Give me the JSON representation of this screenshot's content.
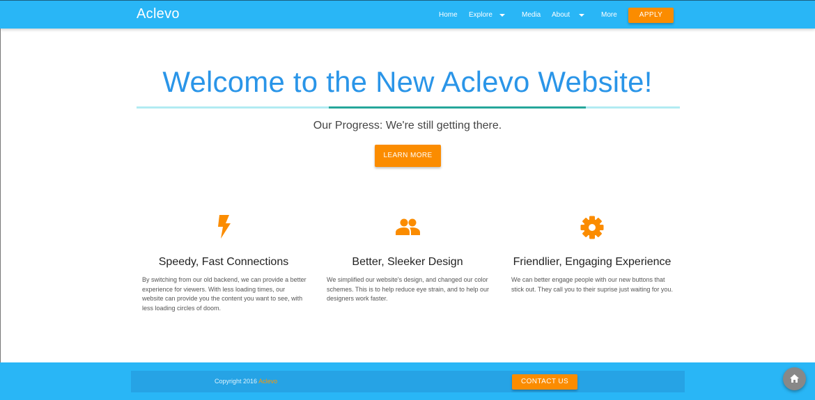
{
  "nav": {
    "brand": "Aclevo",
    "items": [
      "Home",
      "Explore",
      "Media",
      "About",
      "More"
    ],
    "apply_label": "APPLY"
  },
  "hero": {
    "title": "Welcome to the New Aclevo Website!",
    "progress_fraction": 0.473,
    "progress_text": "Our Progress: We're still getting there.",
    "learn_more_label": "LEARN MORE"
  },
  "features": [
    {
      "icon": "lightning-bolt-icon",
      "title": "Speedy, Fast Connections",
      "text": "By switching from our old backend, we can provide a better experience for viewers. With less loading times, our website can provide you the content you want to see, with less loading circles of doom."
    },
    {
      "icon": "people-icon",
      "title": "Better, Sleeker Design",
      "text": "We simplified our website's design, and changed our color schemes. This is to help reduce eye strain, and to help our designers work faster."
    },
    {
      "icon": "gear-icon",
      "title": "Friendlier, Engaging Experience",
      "text": "We can better engage people with our new buttons that stick out. They call you to their suprise just waiting for you."
    }
  ],
  "footer": {
    "copyright_prefix": "Copyright 2016",
    "copyright_brand": "Aclevo",
    "contact_label": "CONTACT US"
  },
  "colors": {
    "primary": "#29b6f6",
    "accent": "#fb8c00",
    "title": "#2a95e8",
    "progress_track": "#b2ebf2",
    "progress_fill": "#26a69a"
  },
  "fab_icon": "home-icon"
}
